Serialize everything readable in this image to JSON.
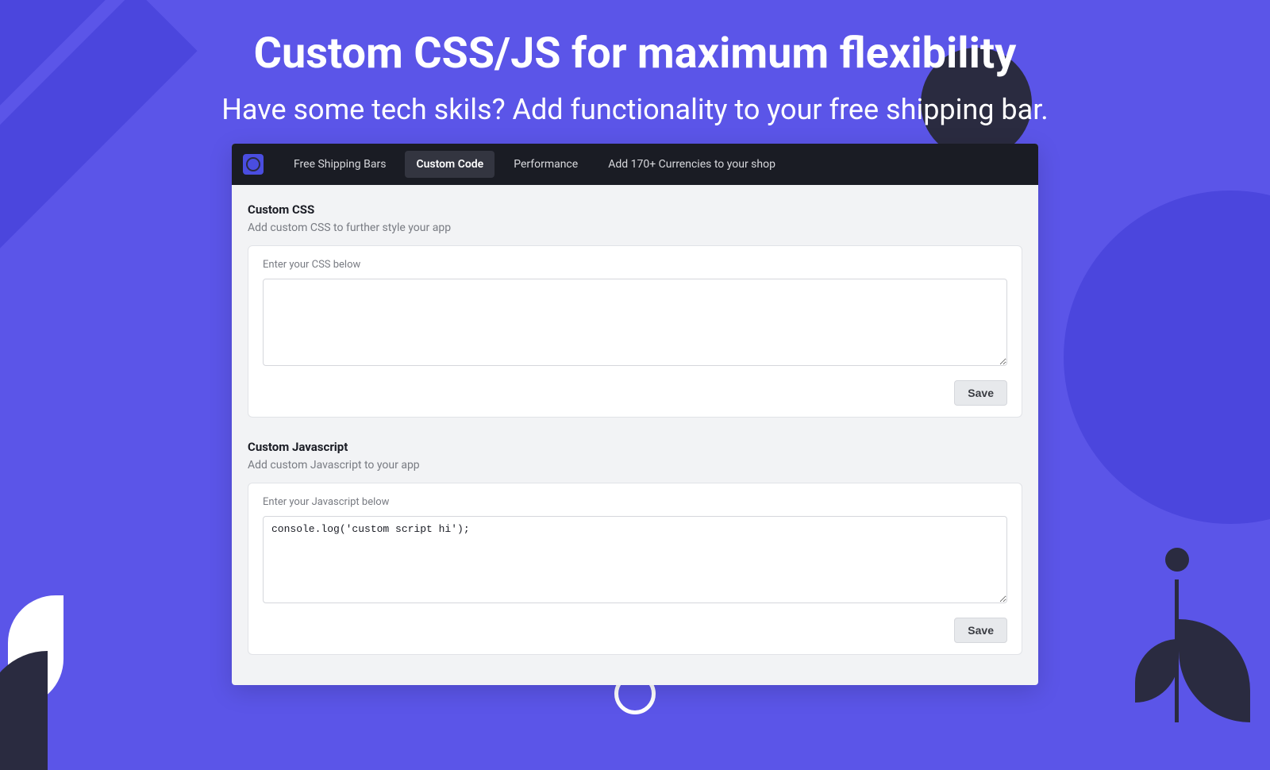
{
  "hero": {
    "title": "Custom CSS/JS for maximum flexibility",
    "subtitle": "Have some tech skils? Add functionality to your free shipping bar."
  },
  "nav": {
    "items": [
      {
        "label": "Free Shipping Bars",
        "active": false
      },
      {
        "label": "Custom Code",
        "active": true
      },
      {
        "label": "Performance",
        "active": false
      },
      {
        "label": "Add 170+ Currencies to your shop",
        "active": false
      }
    ]
  },
  "sections": {
    "css": {
      "title": "Custom CSS",
      "description": "Add custom CSS to further style your app",
      "field_label": "Enter your CSS below",
      "value": "",
      "save_label": "Save"
    },
    "js": {
      "title": "Custom Javascript",
      "description": "Add custom Javascript to your app",
      "field_label": "Enter your Javascript below",
      "value": "console.log('custom script hi');",
      "save_label": "Save"
    }
  }
}
